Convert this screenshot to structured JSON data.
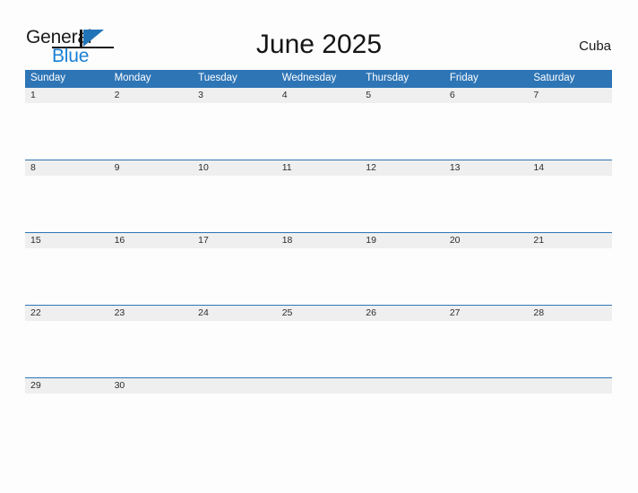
{
  "brand": {
    "name_part1": "General",
    "name_part2": "Blue",
    "logo_icon": "triangle-flag-icon",
    "accent_color": "#1a7fd4"
  },
  "header": {
    "title": "June 2025",
    "region": "Cuba"
  },
  "calendar": {
    "month": "June",
    "year": "2025",
    "header_color": "#2e75b6",
    "date_band_color": "#efefef",
    "day_names": [
      "Sunday",
      "Monday",
      "Tuesday",
      "Wednesday",
      "Thursday",
      "Friday",
      "Saturday"
    ],
    "weeks": [
      {
        "dates": [
          "1",
          "2",
          "3",
          "4",
          "5",
          "6",
          "7"
        ]
      },
      {
        "dates": [
          "8",
          "9",
          "10",
          "11",
          "12",
          "13",
          "14"
        ]
      },
      {
        "dates": [
          "15",
          "16",
          "17",
          "18",
          "19",
          "20",
          "21"
        ]
      },
      {
        "dates": [
          "22",
          "23",
          "24",
          "25",
          "26",
          "27",
          "28"
        ]
      },
      {
        "dates": [
          "29",
          "30",
          "",
          "",
          "",
          "",
          ""
        ]
      }
    ]
  }
}
